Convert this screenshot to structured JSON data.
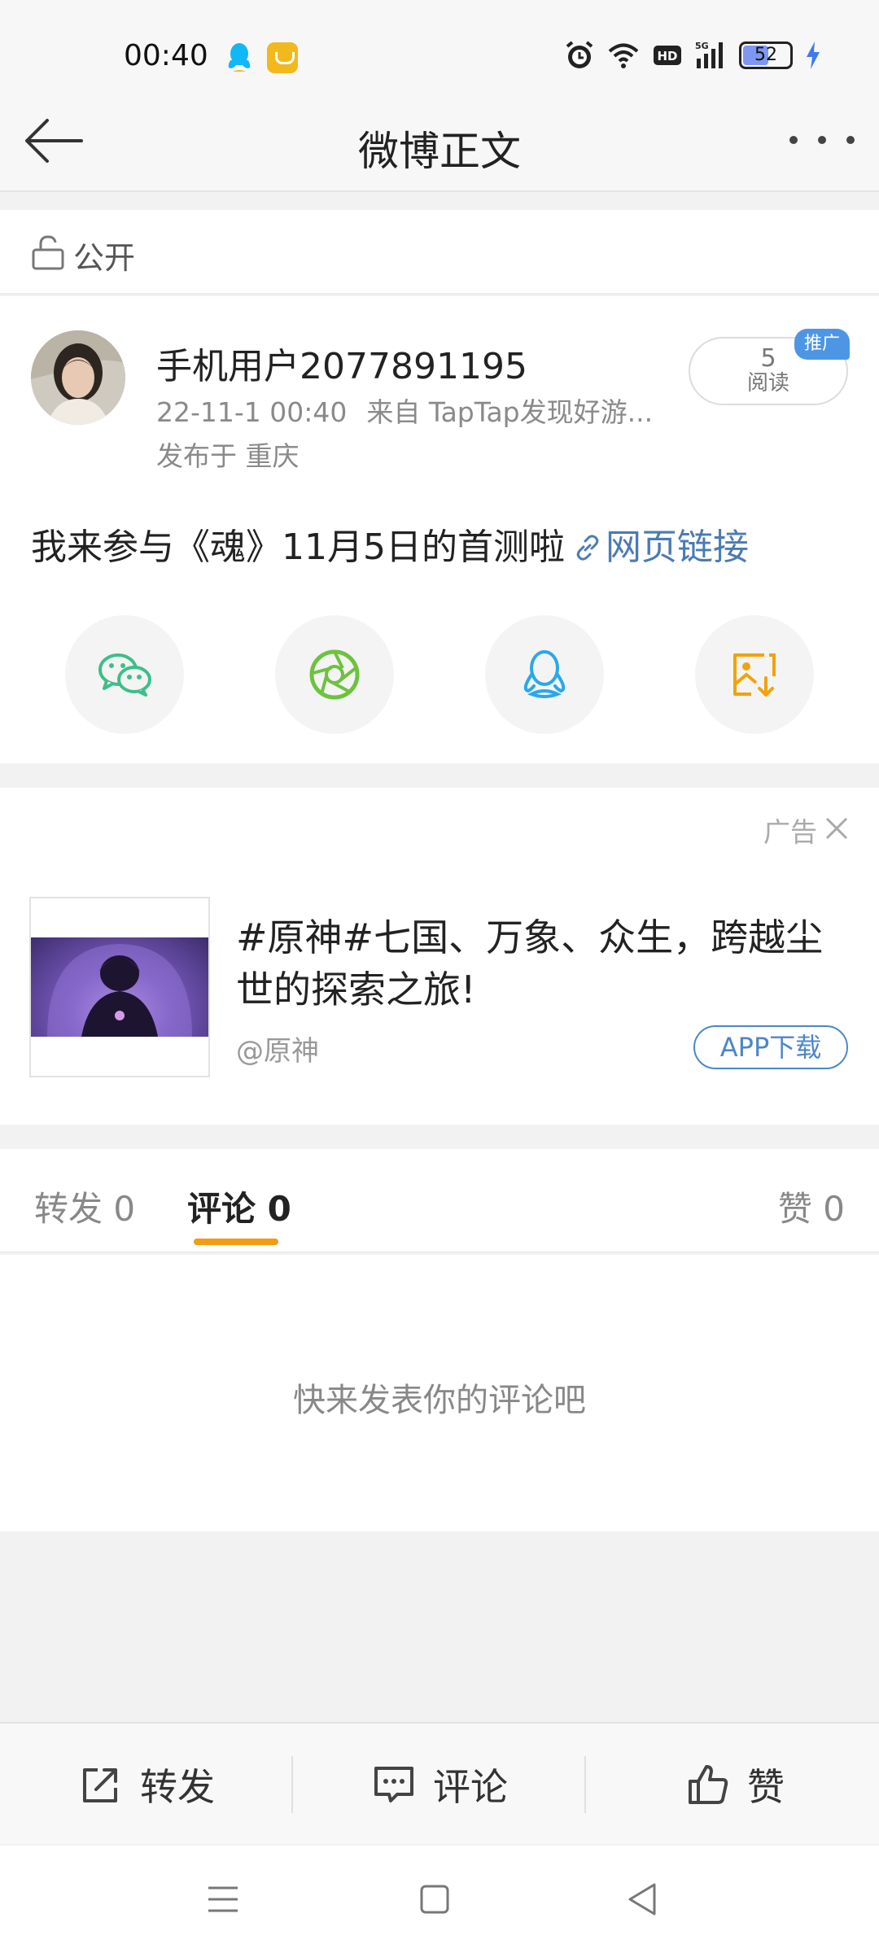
{
  "status_bar": {
    "time": "00:40",
    "network": "5G",
    "hd": "HD",
    "battery": "52",
    "icons": [
      "qq-icon",
      "app-notification-icon",
      "alarm-icon",
      "wifi-icon",
      "hd-icon",
      "signal-icon",
      "battery-icon",
      "charging-icon"
    ]
  },
  "header": {
    "title": "微博正文"
  },
  "visibility": {
    "label": "公开"
  },
  "post": {
    "username": "手机用户2077891195",
    "timestamp": "22-11-1 00:40",
    "source": "来自 TapTap发现好游...",
    "location": "发布于 重庆",
    "read_count": "5",
    "read_label": "阅读",
    "promo_tag": "推广",
    "text": "我来参与《魂》11月5日的首测啦",
    "link_text": "网页链接",
    "share_targets": [
      "wechat-icon",
      "moments-icon",
      "qq-icon",
      "save-image-icon"
    ]
  },
  "ad": {
    "label": "广告",
    "title": "#原神#七国、万象、众生，跨越尘世的探索之旅!",
    "handle": "@原神",
    "download_label": "APP下载"
  },
  "tabs": {
    "repost": "转发 0",
    "comment": "评论 0",
    "like": "赞 0"
  },
  "comments": {
    "empty_text": "快来发表你的评论吧"
  },
  "actions": {
    "repost": "转发",
    "comment": "评论",
    "like": "赞"
  },
  "colors": {
    "accent": "#f39b12",
    "link": "#4a7bb5",
    "promo": "#4d96e4"
  }
}
